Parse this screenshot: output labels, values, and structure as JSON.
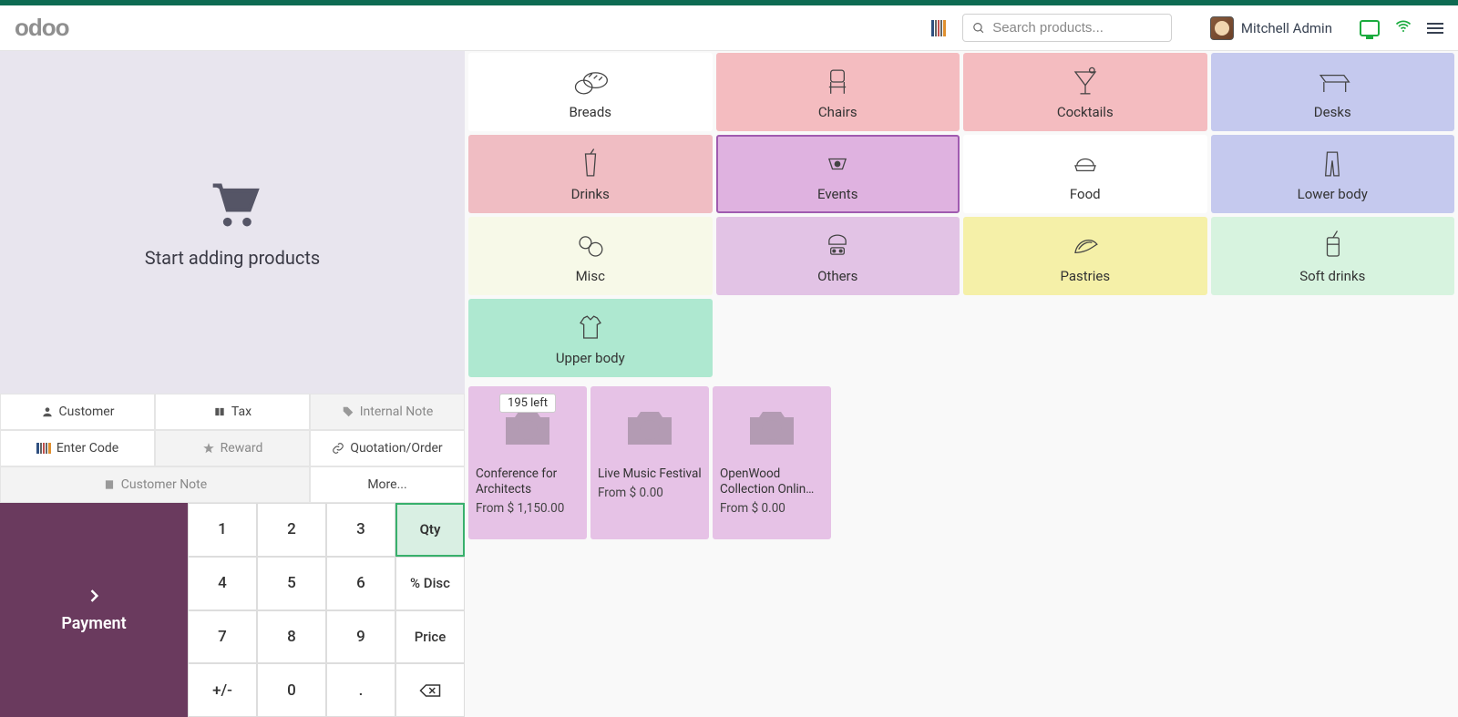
{
  "header": {
    "search_placeholder": "Search products...",
    "username": "Mitchell Admin"
  },
  "cart": {
    "empty_text": "Start adding products"
  },
  "actions": {
    "customer": "Customer",
    "tax": "Tax",
    "internal_note": "Internal Note",
    "enter_code": "Enter Code",
    "reward": "Reward",
    "quotation_order": "Quotation/Order",
    "customer_note": "Customer Note",
    "more": "More..."
  },
  "payment_label": "Payment",
  "numpad": {
    "k1": "1",
    "k2": "2",
    "k3": "3",
    "qty": "Qty",
    "k4": "4",
    "k5": "5",
    "k6": "6",
    "disc": "% Disc",
    "k7": "7",
    "k8": "8",
    "k9": "9",
    "price": "Price",
    "pm": "+/-",
    "k0": "0",
    "dot": "."
  },
  "categories": [
    {
      "label": "Breads",
      "color": "c-white",
      "icon": "bread"
    },
    {
      "label": "Chairs",
      "color": "c-pink1",
      "icon": "chair"
    },
    {
      "label": "Cocktails",
      "color": "c-pink2",
      "icon": "cocktail"
    },
    {
      "label": "Desks",
      "color": "c-lav",
      "icon": "desk"
    },
    {
      "label": "Drinks",
      "color": "c-rose",
      "icon": "drink"
    },
    {
      "label": "Events",
      "color": "c-purple",
      "icon": "event",
      "selected": true
    },
    {
      "label": "Food",
      "color": "c-white",
      "icon": "food"
    },
    {
      "label": "Lower body",
      "color": "c-lav",
      "icon": "pants"
    },
    {
      "label": "Misc",
      "color": "c-beige",
      "icon": "misc"
    },
    {
      "label": "Others",
      "color": "c-lilac",
      "icon": "others"
    },
    {
      "label": "Pastries",
      "color": "c-yellow",
      "icon": "pastry"
    },
    {
      "label": "Soft drinks",
      "color": "c-mint",
      "icon": "softdrink"
    },
    {
      "label": "Upper body",
      "color": "c-teal",
      "icon": "shirt"
    }
  ],
  "products": [
    {
      "name": "Conference for Architects",
      "price": "From $ 1,150.00",
      "badge": "195 left"
    },
    {
      "name": "Live Music Festival",
      "price": "From $ 0.00"
    },
    {
      "name": "OpenWood Collection Onlin…",
      "price": "From $ 0.00"
    }
  ]
}
